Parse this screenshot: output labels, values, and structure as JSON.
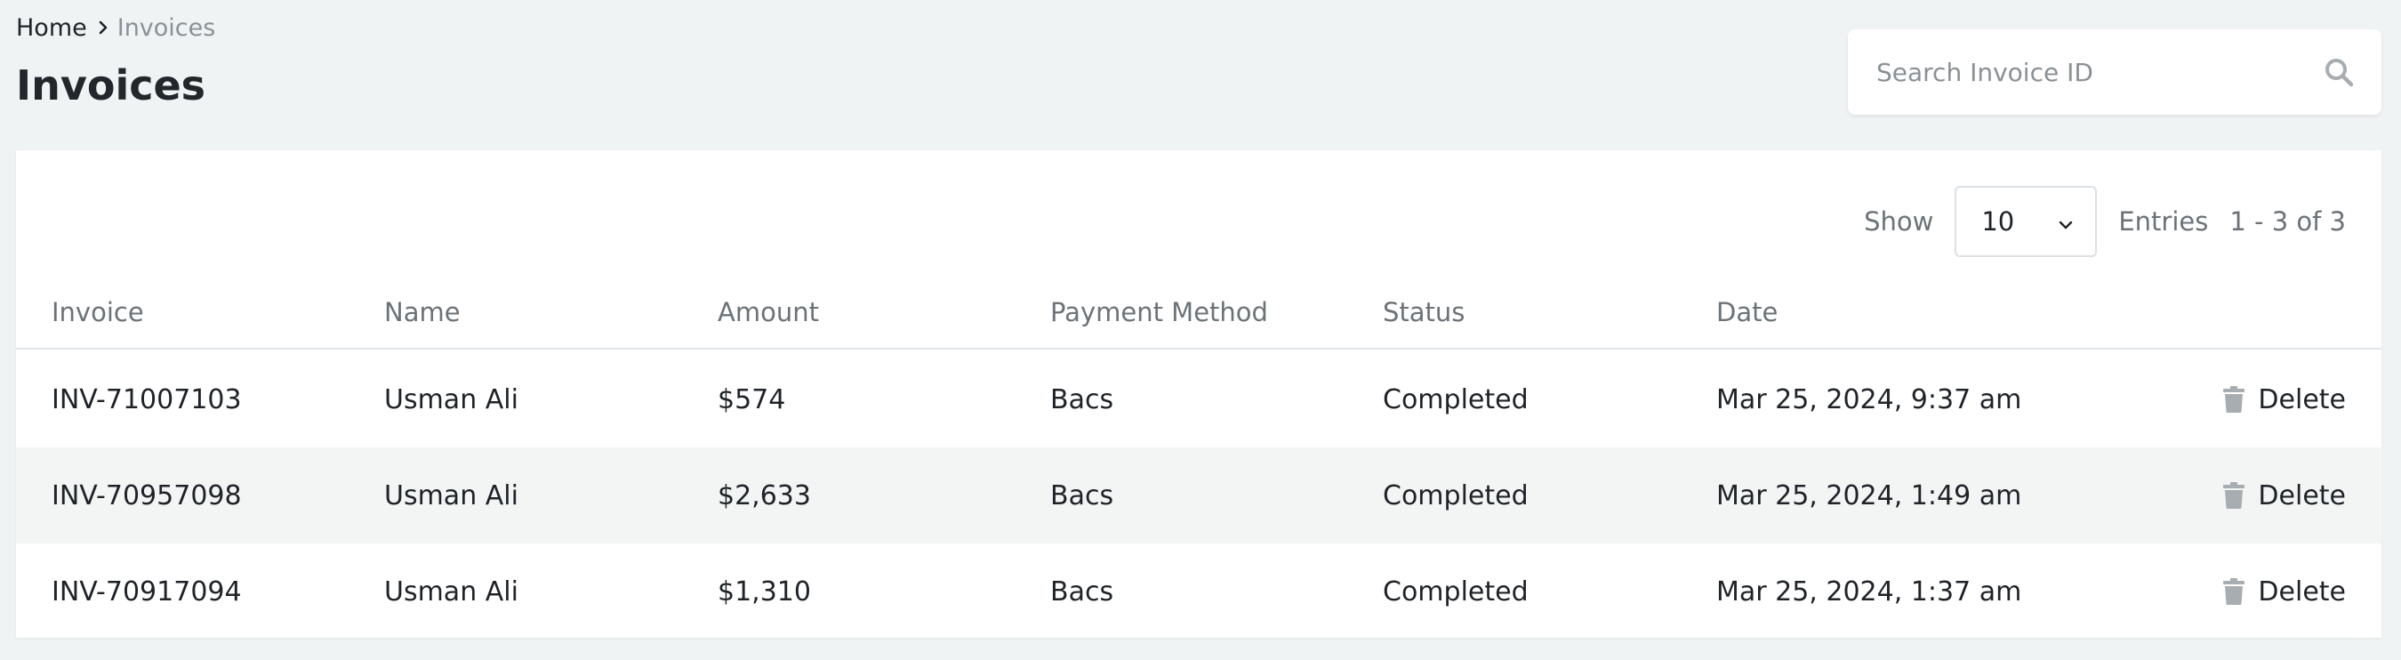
{
  "breadcrumb": {
    "home": "Home",
    "current": "Invoices"
  },
  "page": {
    "title": "Invoices"
  },
  "search": {
    "placeholder": "Search Invoice ID",
    "value": ""
  },
  "toolbar": {
    "show_label": "Show",
    "page_size": "10",
    "entries_label": "Entries",
    "range": "1 - 3 of 3"
  },
  "table": {
    "columns": [
      "Invoice",
      "Name",
      "Amount",
      "Payment Method",
      "Status",
      "Date"
    ],
    "delete_label": "Delete",
    "rows": [
      {
        "invoice": "INV-71007103",
        "name": "Usman Ali",
        "amount": "$574",
        "method": "Bacs",
        "status": "Completed",
        "date": "Mar 25, 2024, 9:37 am"
      },
      {
        "invoice": "INV-70957098",
        "name": "Usman Ali",
        "amount": "$2,633",
        "method": "Bacs",
        "status": "Completed",
        "date": "Mar 25, 2024, 1:49 am"
      },
      {
        "invoice": "INV-70917094",
        "name": "Usman Ali",
        "amount": "$1,310",
        "method": "Bacs",
        "status": "Completed",
        "date": "Mar 25, 2024, 1:37 am"
      }
    ]
  },
  "colors": {
    "page_bg": "#f0f3f4",
    "card_bg": "#ffffff",
    "muted_text": "#6b7378",
    "alt_row_bg": "#f3f5f5",
    "icon_gray": "#a7adb1"
  },
  "icons": {
    "breadcrumb_separator": "chevron-right-icon",
    "search": "search-icon",
    "select": "chevron-down-icon",
    "delete": "trash-icon"
  }
}
